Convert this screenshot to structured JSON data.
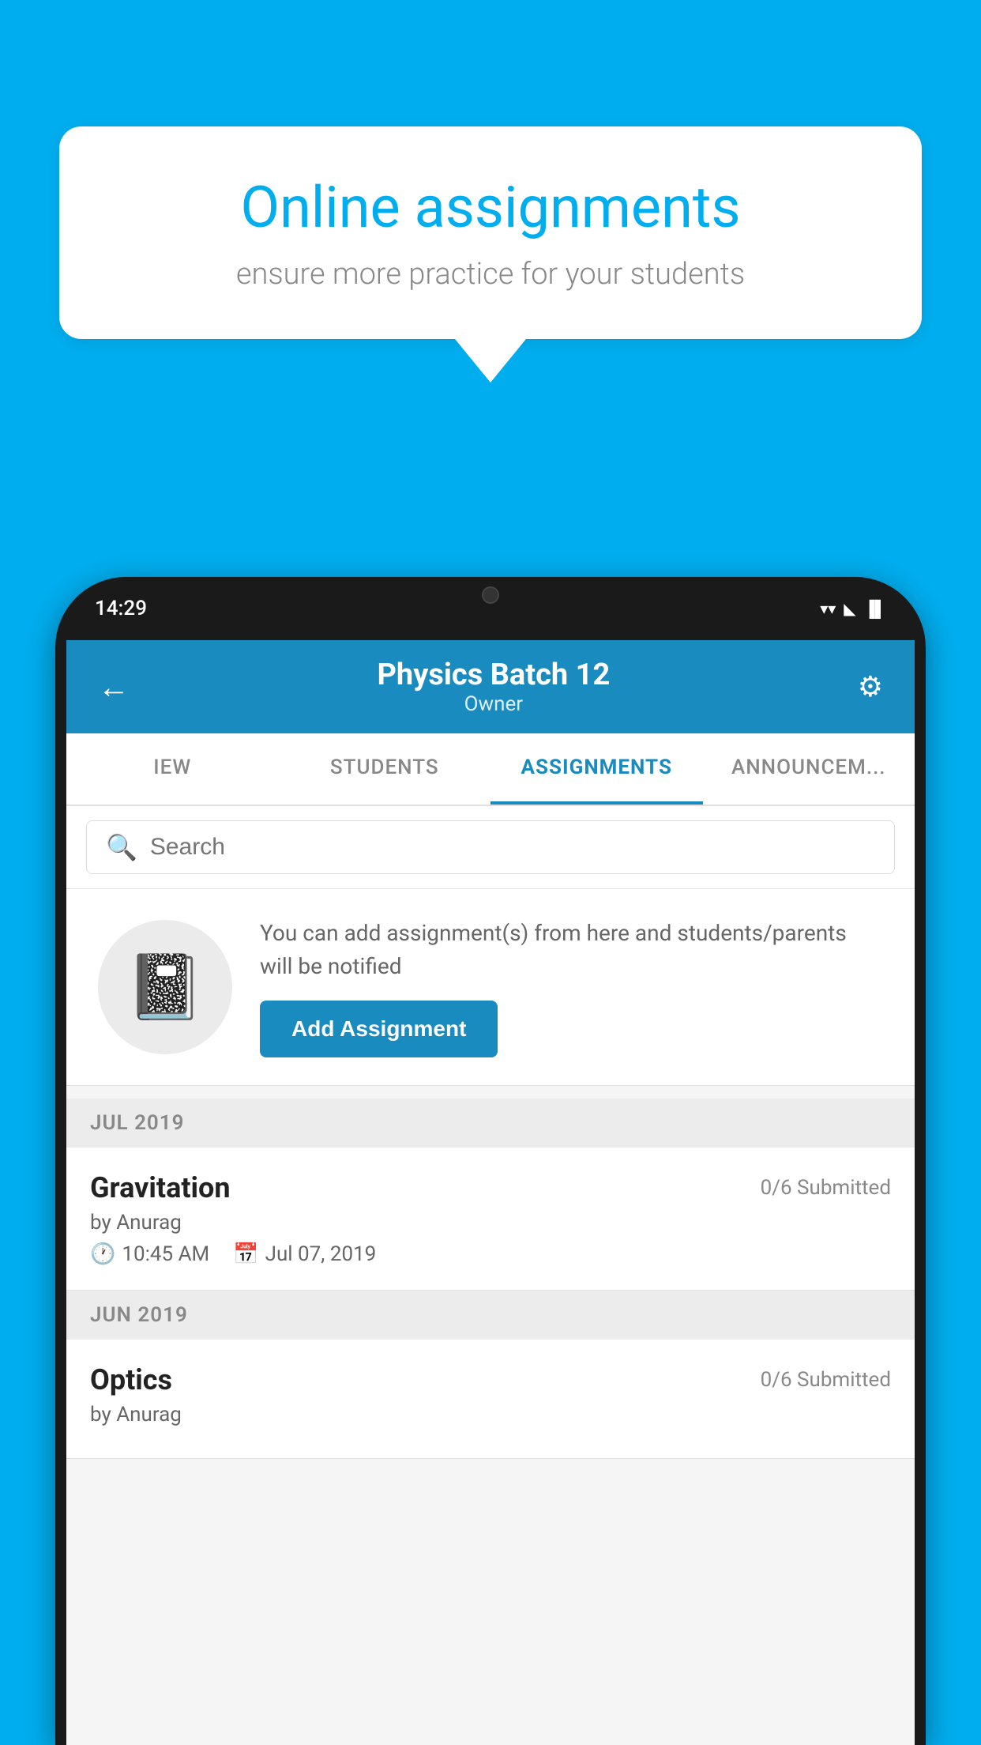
{
  "background_color": "#00AEEF",
  "speech_bubble": {
    "title": "Online assignments",
    "subtitle": "ensure more practice for your students"
  },
  "phone": {
    "status_bar": {
      "time": "14:29",
      "wifi": "▲",
      "signal": "▲",
      "battery": "▌"
    },
    "header": {
      "title": "Physics Batch 12",
      "subtitle": "Owner",
      "back_label": "←",
      "settings_label": "⚙"
    },
    "tabs": [
      {
        "label": "IEW",
        "active": false
      },
      {
        "label": "STUDENTS",
        "active": false
      },
      {
        "label": "ASSIGNMENTS",
        "active": true
      },
      {
        "label": "ANNOUNCEM...",
        "active": false
      }
    ],
    "search": {
      "placeholder": "Search"
    },
    "promo": {
      "description": "You can add assignment(s) from here and students/parents will be notified",
      "button_label": "Add Assignment"
    },
    "sections": [
      {
        "header": "JUL 2019",
        "assignments": [
          {
            "name": "Gravitation",
            "submitted": "0/6 Submitted",
            "by": "by Anurag",
            "time": "10:45 AM",
            "date": "Jul 07, 2019"
          }
        ]
      },
      {
        "header": "JUN 2019",
        "assignments": [
          {
            "name": "Optics",
            "submitted": "0/6 Submitted",
            "by": "by Anurag",
            "time": "",
            "date": ""
          }
        ]
      }
    ]
  }
}
